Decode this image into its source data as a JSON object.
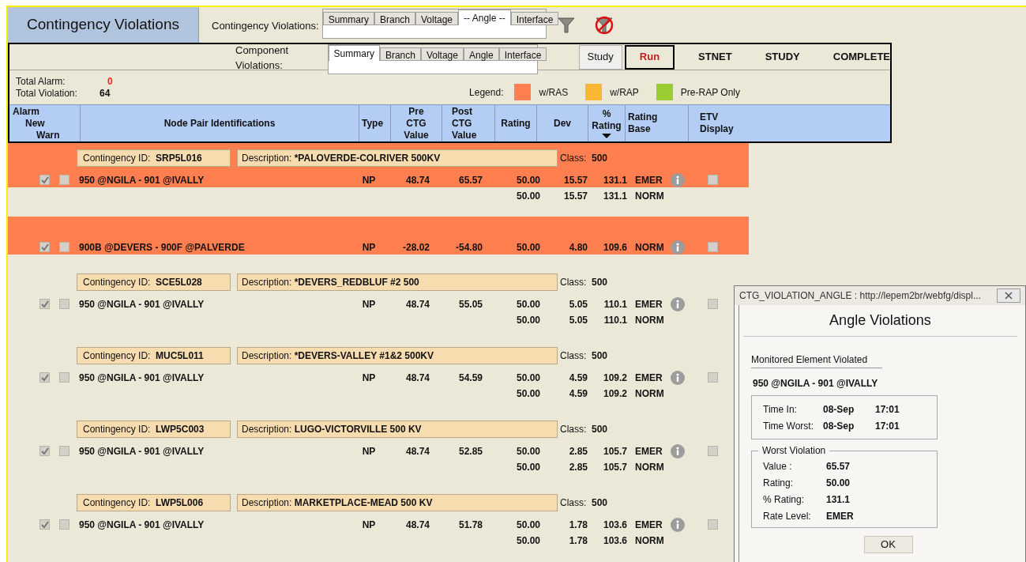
{
  "title": "Contingency Violations",
  "contingency_tabs": {
    "label": "Contingency Violations:",
    "tabs": [
      {
        "label": "Summary",
        "selected": false
      },
      {
        "label": "Branch",
        "selected": false
      },
      {
        "label": "Voltage",
        "selected": false
      },
      {
        "label": "-- Angle --",
        "selected": true
      },
      {
        "label": "Interface",
        "selected": false
      }
    ]
  },
  "component_tabs": {
    "label": "Component Violations:",
    "tabs": [
      {
        "label": "Summary",
        "selected": true
      },
      {
        "label": "Branch",
        "selected": false
      },
      {
        "label": "Voltage",
        "selected": false
      },
      {
        "label": "Angle",
        "selected": false
      },
      {
        "label": "Interface",
        "selected": false
      }
    ]
  },
  "buttons": [
    {
      "label": "Study",
      "kind": "plain"
    },
    {
      "label": "Run",
      "kind": "primary"
    }
  ],
  "status_words": [
    "STNET",
    "STUDY",
    "COMPLETE"
  ],
  "totals": [
    {
      "label": "Total Alarm:",
      "value": "0",
      "kind": "alarm"
    },
    {
      "label": "Total Violation:",
      "value": "64",
      "kind": "normal"
    }
  ],
  "legend": {
    "label": "Legend:",
    "items": [
      {
        "label": "w/RAS",
        "color": "#ff7f50"
      },
      {
        "label": "w/RAP",
        "color": "#fbb734"
      },
      {
        "label": "Pre-RAP Only",
        "color": "#9acd32"
      }
    ]
  },
  "columns": {
    "alarm": [
      "Alarm",
      "New",
      "Warn"
    ],
    "node": "Node Pair Identifications",
    "type": "Type",
    "pre": [
      "Pre",
      "CTG",
      "Value"
    ],
    "post": [
      "Post",
      "CTG",
      "Value"
    ],
    "rating": "Rating",
    "dev": "Dev",
    "pct": [
      "%",
      "Rating"
    ],
    "base": [
      "Rating",
      "Base"
    ],
    "etv": [
      "ETV",
      "Display"
    ]
  },
  "groups": [
    {
      "kind": "ras",
      "id_label": "Contingency ID:",
      "id": "SRP5L016",
      "desc_label": "Description:",
      "desc": "*PALOVERDE-COLRIVER 500KV",
      "class_label": "Class:",
      "class": "500",
      "row": {
        "alarm": true,
        "warn": false,
        "node": "950 @NGILA - 901 @IVALLY",
        "type": "NP",
        "pre": "48.74",
        "post": "65.57",
        "etv": false,
        "ratings": [
          {
            "rating": "50.00",
            "dev": "15.57",
            "pct": "131.1",
            "base": "EMER"
          },
          {
            "rating": "50.00",
            "dev": "15.57",
            "pct": "131.1",
            "base": "NORM"
          }
        ]
      }
    },
    {
      "kind": "ras",
      "row": {
        "alarm": true,
        "warn": false,
        "node": "900B @DEVERS - 900F @PALVERDE",
        "type": "NP",
        "pre": "-28.02",
        "post": "-54.80",
        "etv": false,
        "ratings": [
          {
            "rating": "50.00",
            "dev": "4.80",
            "pct": "109.6",
            "base": "NORM"
          }
        ]
      }
    },
    {
      "kind": "normal",
      "id_label": "Contingency ID:",
      "id": "SCE5L028",
      "desc_label": "Description:",
      "desc": "*DEVERS_REDBLUF #2 500",
      "class_label": "Class:",
      "class": "500",
      "row": {
        "alarm": true,
        "warn": false,
        "node": "950 @NGILA - 901 @IVALLY",
        "type": "NP",
        "pre": "48.74",
        "post": "55.05",
        "etv": false,
        "ratings": [
          {
            "rating": "50.00",
            "dev": "5.05",
            "pct": "110.1",
            "base": "EMER"
          },
          {
            "rating": "50.00",
            "dev": "5.05",
            "pct": "110.1",
            "base": "NORM"
          }
        ]
      }
    },
    {
      "kind": "normal",
      "id_label": "Contingency ID:",
      "id": "MUC5L011",
      "desc_label": "Description:",
      "desc": "*DEVERS-VALLEY #1&2 500KV",
      "class_label": "Class:",
      "class": "500",
      "row": {
        "alarm": true,
        "warn": false,
        "node": "950 @NGILA - 901 @IVALLY",
        "type": "NP",
        "pre": "48.74",
        "post": "54.59",
        "etv": false,
        "ratings": [
          {
            "rating": "50.00",
            "dev": "4.59",
            "pct": "109.2",
            "base": "EMER"
          },
          {
            "rating": "50.00",
            "dev": "4.59",
            "pct": "109.2",
            "base": "NORM"
          }
        ]
      }
    },
    {
      "kind": "normal",
      "id_label": "Contingency ID:",
      "id": "LWP5C003",
      "desc_label": "Description:",
      "desc": "LUGO-VICTORVILLE 500 KV",
      "class_label": "Class:",
      "class": "500",
      "row": {
        "alarm": true,
        "warn": false,
        "node": "950 @NGILA - 901 @IVALLY",
        "type": "NP",
        "pre": "48.74",
        "post": "52.85",
        "etv": false,
        "ratings": [
          {
            "rating": "50.00",
            "dev": "2.85",
            "pct": "105.7",
            "base": "EMER"
          },
          {
            "rating": "50.00",
            "dev": "2.85",
            "pct": "105.7",
            "base": "NORM"
          }
        ]
      }
    },
    {
      "kind": "normal",
      "id_label": "Contingency ID:",
      "id": "LWP5L006",
      "desc_label": "Description:",
      "desc": "MARKETPLACE-MEAD 500 KV",
      "class_label": "Class:",
      "class": "500",
      "row": {
        "alarm": true,
        "warn": false,
        "node": "950 @NGILA - 901 @IVALLY",
        "type": "NP",
        "pre": "48.74",
        "post": "51.78",
        "etv": false,
        "ratings": [
          {
            "rating": "50.00",
            "dev": "1.78",
            "pct": "103.6",
            "base": "EMER"
          },
          {
            "rating": "50.00",
            "dev": "1.78",
            "pct": "103.6",
            "base": "NORM"
          }
        ]
      }
    }
  ],
  "dialog": {
    "title": "CTG_VIOLATION_ANGLE : http://lepem2br/webfg/displ...",
    "heading": "Angle Violations",
    "section": "Monitored Element Violated",
    "element": "950 @NGILA - 901 @IVALLY",
    "times": [
      {
        "label": "Time In:",
        "date": "08-Sep",
        "time": "17:01"
      },
      {
        "label": "Time Worst:",
        "date": "08-Sep",
        "time": "17:01"
      }
    ],
    "worst": {
      "legend": "Worst Violation",
      "fields": [
        {
          "label": "Value :",
          "value": "65.57"
        },
        {
          "label": "Rating:",
          "value": "50.00"
        },
        {
          "label": "% Rating:",
          "value": "131.1"
        },
        {
          "label": "Rate Level:",
          "value": "EMER"
        }
      ]
    },
    "ok": "OK"
  }
}
